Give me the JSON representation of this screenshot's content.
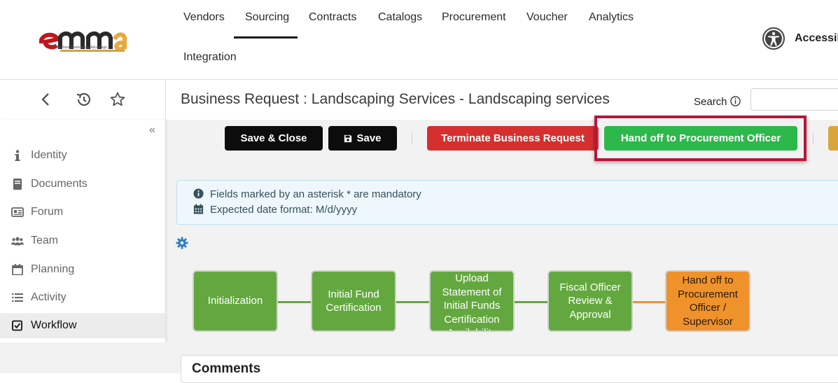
{
  "brand": {
    "logo_text": "emma",
    "logo_tagline": "eMaryland Marketplace Advantage"
  },
  "nav": {
    "items": [
      "Vendors",
      "Sourcing",
      "Contracts",
      "Catalogs",
      "Procurement",
      "Voucher",
      "Analytics",
      "Integration"
    ],
    "active": "Sourcing",
    "accessibility_label": "Accessib"
  },
  "subbar": {
    "icons": [
      "back-icon",
      "history-icon",
      "star-icon"
    ],
    "title": "Business Request : Landscaping Services - Landscaping services",
    "search_label": "Search"
  },
  "sidebar": {
    "items": [
      {
        "label": "Identity",
        "icon": "info-icon"
      },
      {
        "label": "Documents",
        "icon": "book-icon"
      },
      {
        "label": "Forum",
        "icon": "forum-icon"
      },
      {
        "label": "Team",
        "icon": "team-icon"
      },
      {
        "label": "Planning",
        "icon": "calendar-icon"
      },
      {
        "label": "Activity",
        "icon": "list-icon"
      },
      {
        "label": "Workflow",
        "icon": "checkbox-icon"
      }
    ],
    "active": "Workflow"
  },
  "actions": {
    "save_close": "Save & Close",
    "save": "Save",
    "terminate": "Terminate Business Request",
    "handoff": "Hand off to Procurement Officer"
  },
  "info": {
    "mandatory": "Fields marked by an asterisk * are mandatory",
    "date_format": "Expected date format: M/d/yyyy"
  },
  "workflow": {
    "steps": [
      {
        "label": "Initialization",
        "status": "complete"
      },
      {
        "label": "Initial Fund Certification",
        "status": "complete"
      },
      {
        "label": "Upload Statement of Initial Funds Certification Availability",
        "status": "complete"
      },
      {
        "label": "Fiscal Officer Review & Approval",
        "status": "complete"
      },
      {
        "label": "Hand off to Procurement Officer / Supervisor",
        "status": "current"
      }
    ]
  },
  "comments": {
    "title": "Comments"
  },
  "colors": {
    "accent_green": "#2db84b",
    "danger_red": "#d62f2f",
    "highlight": "#b5173b",
    "step_green": "#63a83f",
    "step_orange": "#f0922b"
  }
}
